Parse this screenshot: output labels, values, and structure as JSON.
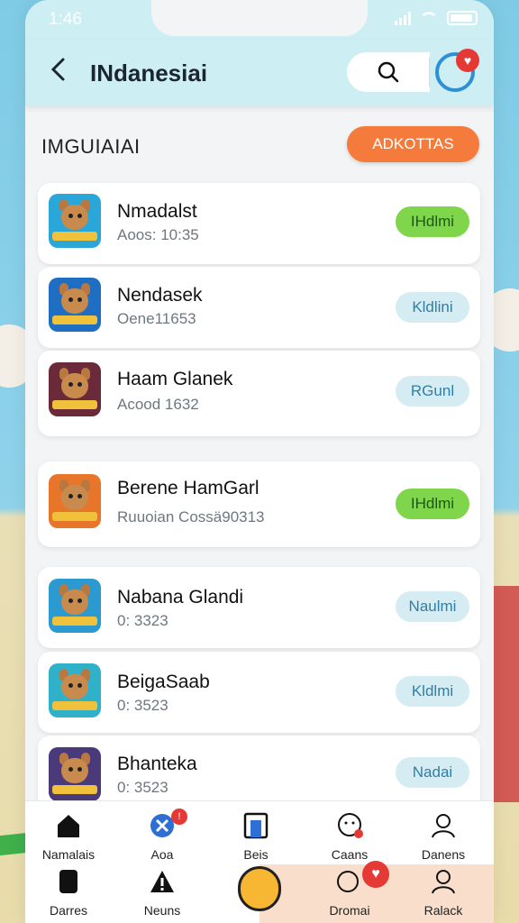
{
  "status": {
    "time": "1:46"
  },
  "header": {
    "title": "INdanesiai",
    "back_icon": "back-arrow-icon",
    "search_icon": "search-icon"
  },
  "section": {
    "title": "IMGUIAIAI",
    "action_label": "ADKOTTAS",
    "action_color": "#f47b3c"
  },
  "apps": [
    {
      "name": "Nmadalst",
      "sub": "Aoos: 10:35",
      "button": "IHdlmi",
      "style": "green"
    },
    {
      "name": "Nendasek",
      "sub": "Oene11653",
      "button": "Kldlini",
      "style": "blue"
    },
    {
      "name": "Haam Glanek",
      "sub": "Acood 1632",
      "button": "RGunl",
      "style": "blue"
    },
    {
      "name": "Berene HamGarl",
      "sub": "Ruuoian Cossä90313",
      "button": "IHdlmi",
      "style": "green"
    },
    {
      "name": "Nabana Glandi",
      "sub": "0: 3323",
      "button": "Naulmi",
      "style": "blue"
    },
    {
      "name": "BeigaSaab",
      "sub": "0: 3523",
      "button": "Kldlmi",
      "style": "blue"
    },
    {
      "name": "Bhanteka",
      "sub": "0: 3523",
      "button": "Nadai",
      "style": "blue"
    }
  ],
  "tabs_top": [
    {
      "label": "Namalais",
      "icon": "home-icon"
    },
    {
      "label": "Aoa",
      "icon": "close-circle-icon",
      "badge": "!"
    },
    {
      "label": "Beis",
      "icon": "tablet-icon"
    },
    {
      "label": "Caans",
      "icon": "chat-icon"
    },
    {
      "label": "Danens",
      "icon": "profile-icon"
    }
  ],
  "tabs_bottom": [
    {
      "label": "Darres",
      "icon": "phone-icon"
    },
    {
      "label": "Neuns",
      "icon": "warning-icon"
    },
    {
      "label": "",
      "icon": "smiley-face-icon"
    },
    {
      "label": "Dromai",
      "icon": "chat-heart-icon"
    },
    {
      "label": "Ralack",
      "icon": "profile-icon"
    }
  ]
}
